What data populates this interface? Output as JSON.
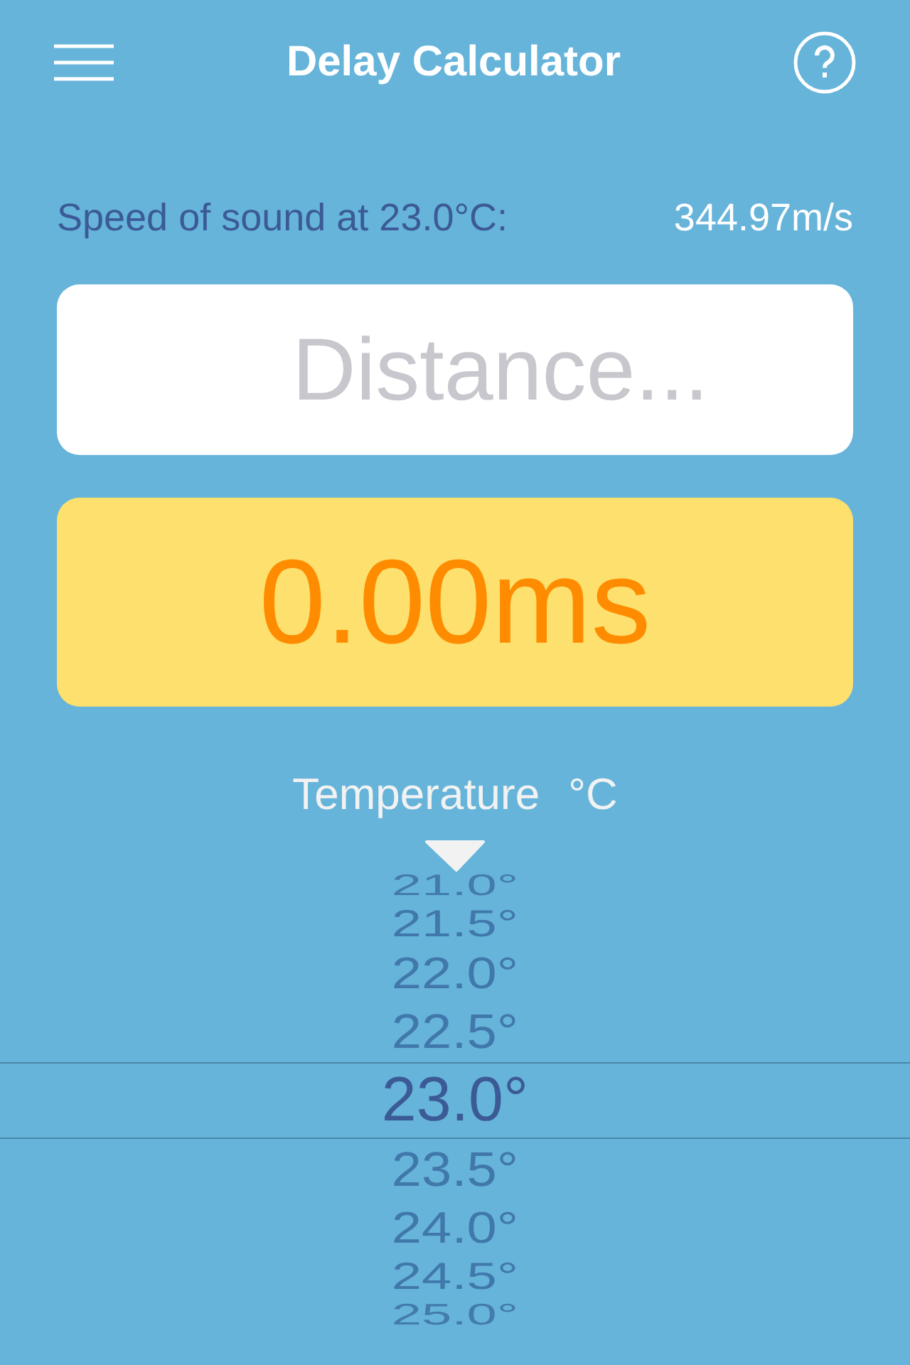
{
  "header": {
    "title": "Delay Calculator"
  },
  "speed": {
    "label": "Speed of sound at 23.0°C:",
    "value": "344.97m/s"
  },
  "distance_field": {
    "placeholder": "Distance..."
  },
  "result": "0.00ms",
  "temperature": {
    "label": "Temperature",
    "unit": "°C"
  },
  "picker_items": [
    {
      "label": "21.0°",
      "selected": false
    },
    {
      "label": "21.5°",
      "selected": false
    },
    {
      "label": "22.0°",
      "selected": false
    },
    {
      "label": "22.5°",
      "selected": false
    },
    {
      "label": "23.0°",
      "selected": true
    },
    {
      "label": "23.5°",
      "selected": false
    },
    {
      "label": "24.0°",
      "selected": false
    },
    {
      "label": "24.5°",
      "selected": false
    },
    {
      "label": "25.0°",
      "selected": false
    }
  ]
}
